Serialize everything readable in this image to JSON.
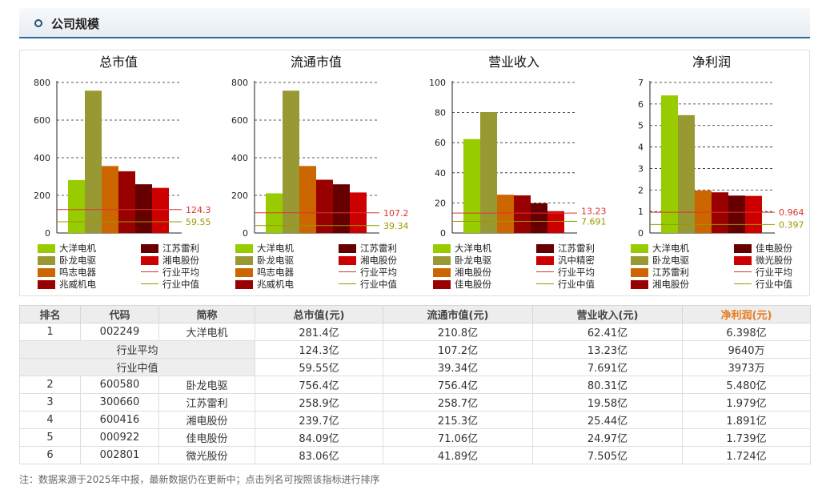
{
  "section_title": "公司规模",
  "note": "注：数据来源于2025年中报，最新数据仍在更新中；点击列名可按照该指标进行排序",
  "colors": {
    "series": [
      "#99cc00",
      "#999933",
      "#cc6600",
      "#990000",
      "#660000",
      "#cc0000"
    ],
    "avg_line": "#dd3333",
    "median_line": "#999900"
  },
  "chart_data": [
    {
      "type": "bar",
      "title": "总市值",
      "yticks": [
        "800",
        "600",
        "400",
        "200",
        "0"
      ],
      "ylim": [
        0,
        800
      ],
      "grid": "dashed",
      "categories": [
        "大洋电机",
        "卧龙电驱",
        "鸣志电器",
        "江苏雷利",
        "兆威机电",
        "湘电股份"
      ],
      "values": [
        281.4,
        756.4,
        356.0,
        328.0,
        258.9,
        239.7
      ],
      "avg": 124.3,
      "avg_label": "124.3",
      "median": 59.55,
      "median_label": "59.55",
      "legend": [
        {
          "label": "大洋电机",
          "kind": "bar",
          "color": "#99cc00"
        },
        {
          "label": "江苏雷利",
          "kind": "bar",
          "color": "#660000"
        },
        {
          "label": "卧龙电驱",
          "kind": "bar",
          "color": "#999933"
        },
        {
          "label": "湘电股份",
          "kind": "bar",
          "color": "#cc0000"
        },
        {
          "label": "鸣志电器",
          "kind": "bar",
          "color": "#cc6600"
        },
        {
          "label": "行业平均",
          "kind": "line",
          "color": "#dd3333"
        },
        {
          "label": "兆威机电",
          "kind": "bar",
          "color": "#990000"
        },
        {
          "label": "行业中值",
          "kind": "line",
          "color": "#999900"
        }
      ]
    },
    {
      "type": "bar",
      "title": "流通市值",
      "yticks": [
        "800",
        "600",
        "400",
        "200",
        "0"
      ],
      "ylim": [
        0,
        800
      ],
      "grid": "dashed",
      "categories": [
        "大洋电机",
        "卧龙电驱",
        "鸣志电器",
        "兆威机电",
        "江苏雷利",
        "湘电股份"
      ],
      "values": [
        210.8,
        756.4,
        356.0,
        283.0,
        258.7,
        215.3
      ],
      "avg": 107.2,
      "avg_label": "107.2",
      "median": 39.34,
      "median_label": "39.34",
      "legend": [
        {
          "label": "大洋电机",
          "kind": "bar",
          "color": "#99cc00"
        },
        {
          "label": "江苏雷利",
          "kind": "bar",
          "color": "#660000"
        },
        {
          "label": "卧龙电驱",
          "kind": "bar",
          "color": "#999933"
        },
        {
          "label": "湘电股份",
          "kind": "bar",
          "color": "#cc0000"
        },
        {
          "label": "鸣志电器",
          "kind": "bar",
          "color": "#cc6600"
        },
        {
          "label": "行业平均",
          "kind": "line",
          "color": "#dd3333"
        },
        {
          "label": "兆威机电",
          "kind": "bar",
          "color": "#990000"
        },
        {
          "label": "行业中值",
          "kind": "line",
          "color": "#999900"
        }
      ]
    },
    {
      "type": "bar",
      "title": "营业收入",
      "yticks": [
        "100",
        "80",
        "60",
        "40",
        "20",
        "0"
      ],
      "ylim": [
        0,
        100
      ],
      "grid": "dashed",
      "categories": [
        "大洋电机",
        "卧龙电驱",
        "湘电股份",
        "佳电股份",
        "汎中精密",
        "江苏雷利"
      ],
      "values": [
        62.41,
        80.31,
        25.44,
        24.97,
        19.8,
        14.5
      ],
      "avg": 13.23,
      "avg_label": "13.23",
      "median": 7.691,
      "median_label": "7.691",
      "legend": [
        {
          "label": "大洋电机",
          "kind": "bar",
          "color": "#99cc00"
        },
        {
          "label": "江苏雷利",
          "kind": "bar",
          "color": "#660000"
        },
        {
          "label": "卧龙电驱",
          "kind": "bar",
          "color": "#999933"
        },
        {
          "label": "汎中精密",
          "kind": "bar",
          "color": "#cc0000"
        },
        {
          "label": "湘电股份",
          "kind": "bar",
          "color": "#cc6600"
        },
        {
          "label": "行业平均",
          "kind": "line",
          "color": "#dd3333"
        },
        {
          "label": "佳电股份",
          "kind": "bar",
          "color": "#990000"
        },
        {
          "label": "行业中值",
          "kind": "line",
          "color": "#999900"
        }
      ]
    },
    {
      "type": "bar",
      "title": "净利润",
      "yticks": [
        "7",
        "6",
        "5",
        "4",
        "3",
        "2",
        "1",
        "0"
      ],
      "ylim": [
        0,
        7
      ],
      "grid": "dashed",
      "categories": [
        "大洋电机",
        "卧龙电驱",
        "江苏雷利",
        "湘电股份",
        "佳电股份",
        "微光股份"
      ],
      "values": [
        6.398,
        5.48,
        1.979,
        1.891,
        1.739,
        1.724
      ],
      "avg": 0.964,
      "avg_label": "0.964",
      "median": 0.397,
      "median_label": "0.397",
      "legend": [
        {
          "label": "大洋电机",
          "kind": "bar",
          "color": "#99cc00"
        },
        {
          "label": "佳电股份",
          "kind": "bar",
          "color": "#660000"
        },
        {
          "label": "卧龙电驱",
          "kind": "bar",
          "color": "#999933"
        },
        {
          "label": "微光股份",
          "kind": "bar",
          "color": "#cc0000"
        },
        {
          "label": "江苏雷利",
          "kind": "bar",
          "color": "#cc6600"
        },
        {
          "label": "行业平均",
          "kind": "line",
          "color": "#dd3333"
        },
        {
          "label": "湘电股份",
          "kind": "bar",
          "color": "#990000"
        },
        {
          "label": "行业中值",
          "kind": "line",
          "color": "#999900"
        }
      ]
    }
  ],
  "table": {
    "headers": [
      "排名",
      "代码",
      "简称",
      "总市值(元)",
      "流通市值(元)",
      "营业收入(元)",
      "净利润(元)"
    ],
    "rows": [
      {
        "kind": "company",
        "rank": "1",
        "code": "002249",
        "name": "大洋电机",
        "mktcap": "281.4亿",
        "float": "210.8亿",
        "revenue": "62.41亿",
        "profit": "6.398亿"
      },
      {
        "kind": "stat",
        "label": "行业平均",
        "mktcap": "124.3亿",
        "float": "107.2亿",
        "revenue": "13.23亿",
        "profit": "9640万"
      },
      {
        "kind": "stat",
        "label": "行业中值",
        "mktcap": "59.55亿",
        "float": "39.34亿",
        "revenue": "7.691亿",
        "profit": "3973万"
      },
      {
        "kind": "company",
        "rank": "2",
        "code": "600580",
        "name": "卧龙电驱",
        "mktcap": "756.4亿",
        "float": "756.4亿",
        "revenue": "80.31亿",
        "profit": "5.480亿"
      },
      {
        "kind": "company",
        "rank": "3",
        "code": "300660",
        "name": "江苏雷利",
        "mktcap": "258.9亿",
        "float": "258.7亿",
        "revenue": "19.58亿",
        "profit": "1.979亿"
      },
      {
        "kind": "company",
        "rank": "4",
        "code": "600416",
        "name": "湘电股份",
        "mktcap": "239.7亿",
        "float": "215.3亿",
        "revenue": "25.44亿",
        "profit": "1.891亿"
      },
      {
        "kind": "company",
        "rank": "5",
        "code": "000922",
        "name": "佳电股份",
        "mktcap": "84.09亿",
        "float": "71.06亿",
        "revenue": "24.97亿",
        "profit": "1.739亿"
      },
      {
        "kind": "company",
        "rank": "6",
        "code": "002801",
        "name": "微光股份",
        "mktcap": "83.06亿",
        "float": "41.89亿",
        "revenue": "7.505亿",
        "profit": "1.724亿"
      }
    ]
  }
}
